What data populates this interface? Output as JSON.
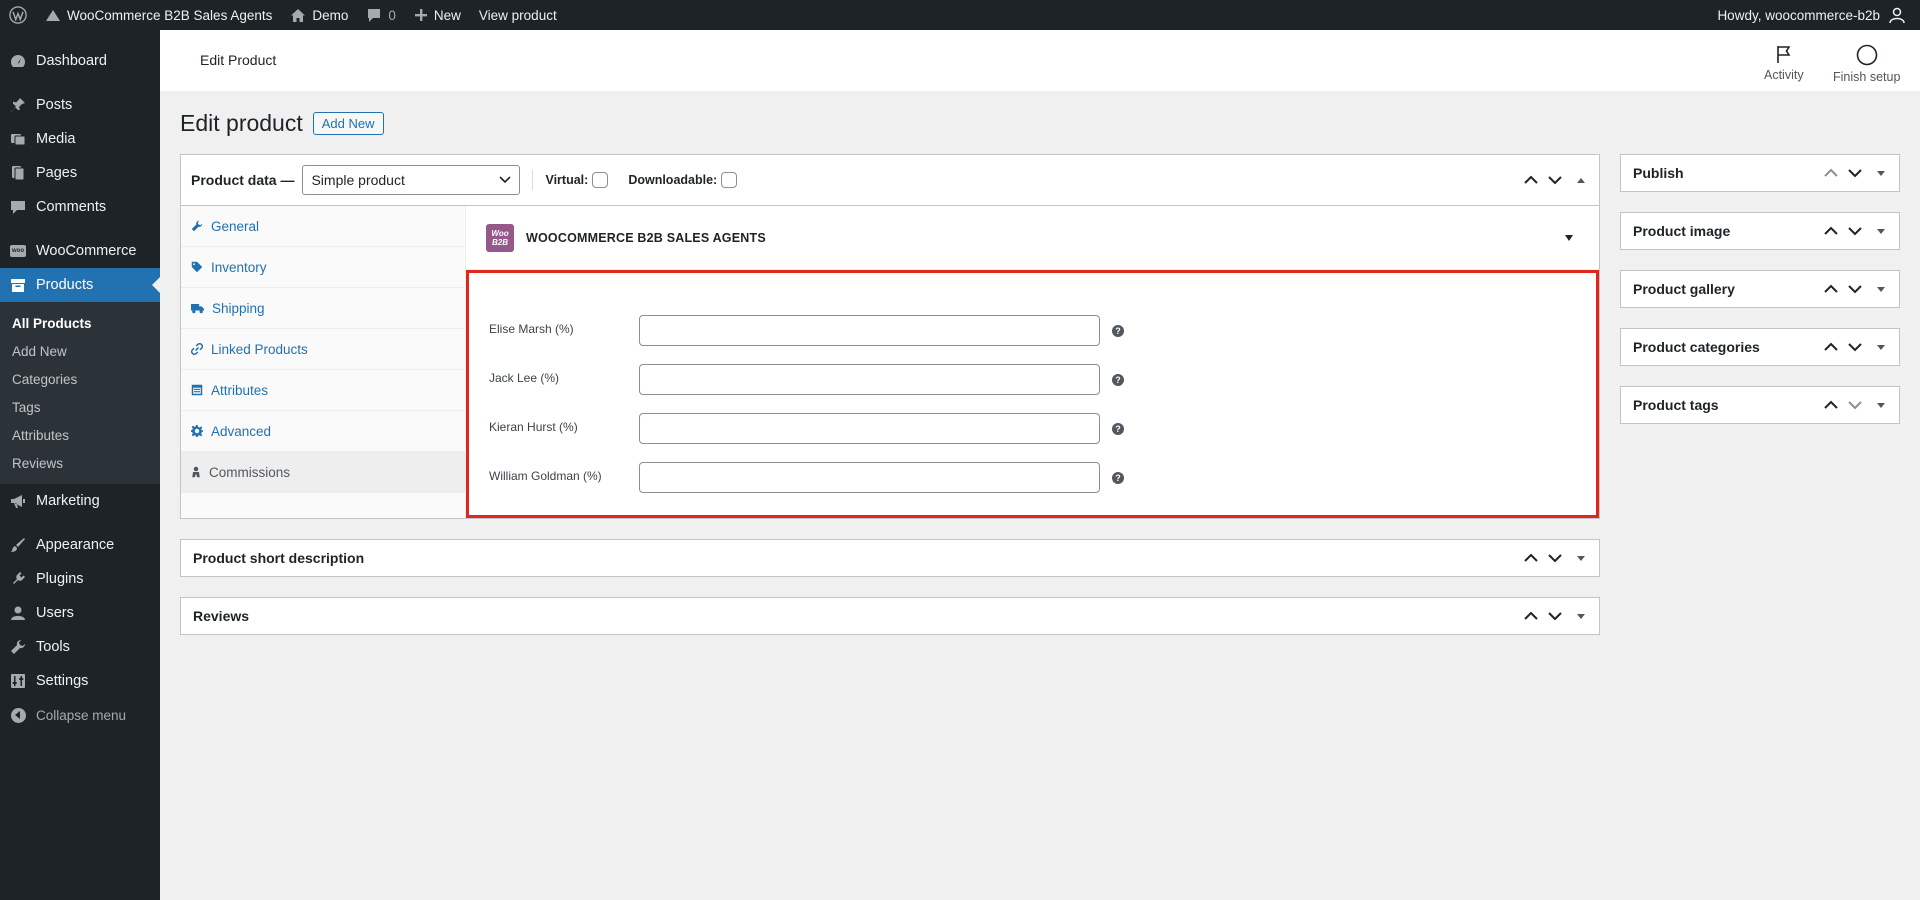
{
  "adminbar": {
    "site_name": "WooCommerce B2B Sales Agents",
    "demo_label": "Demo",
    "comments_count": "0",
    "new_label": "New",
    "view_product_label": "View product",
    "howdy": "Howdy, woocommerce-b2b"
  },
  "sidebar": {
    "dashboard": "Dashboard",
    "posts": "Posts",
    "media": "Media",
    "pages": "Pages",
    "comments": "Comments",
    "woocommerce": "WooCommerce",
    "products": "Products",
    "submenu": [
      "All Products",
      "Add New",
      "Categories",
      "Tags",
      "Attributes",
      "Reviews"
    ],
    "marketing": "Marketing",
    "appearance": "Appearance",
    "plugins": "Plugins",
    "users": "Users",
    "tools": "Tools",
    "settings": "Settings",
    "collapse": "Collapse menu",
    "woo_badge": "woo"
  },
  "woo_header": {
    "title": "Edit Product",
    "activity": "Activity",
    "finish_setup": "Finish setup"
  },
  "page": {
    "heading": "Edit product",
    "add_new": "Add New"
  },
  "product_data": {
    "label": "Product data —",
    "product_type": "Simple product",
    "virtual_label": "Virtual:",
    "downloadable_label": "Downloadable:",
    "tabs": [
      "General",
      "Inventory",
      "Shipping",
      "Linked Products",
      "Attributes",
      "Advanced",
      "Commissions"
    ],
    "active_tab": "Commissions",
    "plugin_logo_top": "Woo",
    "plugin_logo_bottom": "B2B",
    "plugin_title": "WOOCOMMERCE B2B SALES AGENTS",
    "agents": [
      {
        "label": "Elise Marsh (%)",
        "value": ""
      },
      {
        "label": "Jack Lee (%)",
        "value": ""
      },
      {
        "label": "Kieran Hurst (%)",
        "value": ""
      },
      {
        "label": "William Goldman (%)",
        "value": ""
      }
    ],
    "help_glyph": "?"
  },
  "boxes": {
    "short_description": "Product short description",
    "reviews": "Reviews"
  },
  "side_boxes": [
    "Publish",
    "Product image",
    "Product gallery",
    "Product categories",
    "Product tags"
  ]
}
